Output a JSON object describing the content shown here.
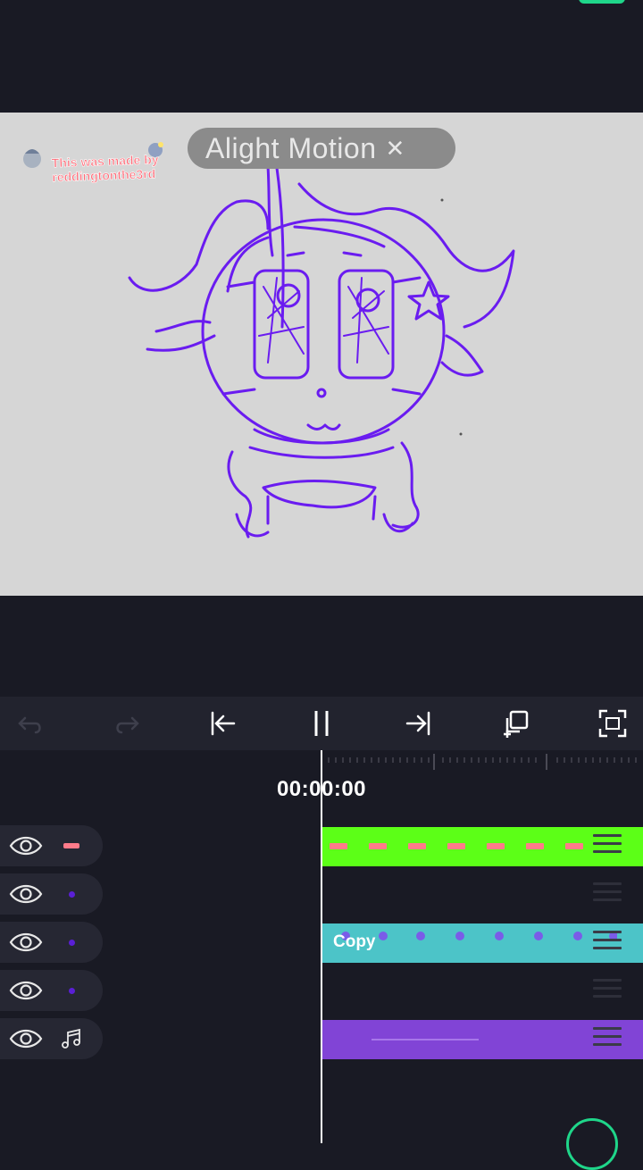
{
  "app": {
    "watermark_text": "Alight Motion",
    "creator_badge": "This was made by reddingtonthe3rd"
  },
  "timeline": {
    "timecode": "00:00:00",
    "tracks": [
      {
        "visibility": "visible",
        "thumb": "sticker-thumbnail",
        "clip_color": "#5cff17",
        "clip_label": ""
      },
      {
        "visibility": "visible",
        "thumb": "purple-dot",
        "clip_color": "",
        "clip_label": ""
      },
      {
        "visibility": "visible",
        "thumb": "purple-dot",
        "clip_color": "#4cc4c8",
        "clip_label": "Copy"
      },
      {
        "visibility": "visible",
        "thumb": "purple-dot",
        "clip_color": "",
        "clip_label": ""
      },
      {
        "visibility": "visible",
        "thumb": "music-note-icon",
        "clip_color": "#8144d6",
        "clip_label": ""
      }
    ]
  },
  "colors": {
    "background": "#191a24",
    "canvas": "#d6d6d6",
    "sketch": "#6a1cf0",
    "accent": "#1fd68a"
  }
}
